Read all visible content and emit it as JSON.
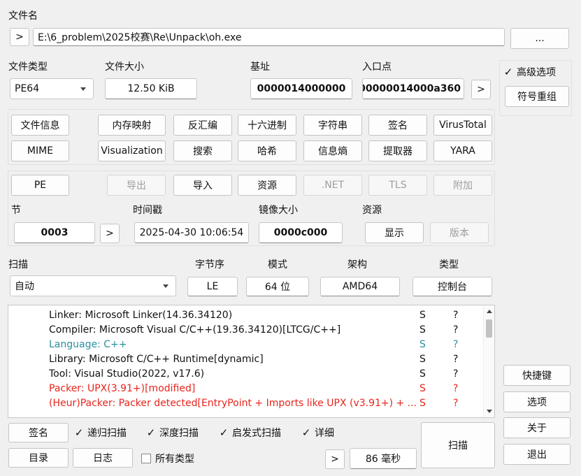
{
  "file": {
    "label": "文件名",
    "browse_arrow": ">",
    "path": "E:\\6_problem\\2025校赛\\Re\\Unpack\\oh.exe",
    "dots": "..."
  },
  "info": {
    "type_label": "文件类型",
    "type_value": "PE64",
    "size_label": "文件大小",
    "size_value": "12.50 KiB",
    "base_label": "基址",
    "base_value": "0000014000000",
    "entry_label": "入口点",
    "entry_value": "00000014000a360",
    "entry_arrow": ">"
  },
  "right_panel": {
    "advanced_check": "✓",
    "advanced_label": "高级选项",
    "symbol_button": "符号重组",
    "shortcut_button": "快捷键",
    "options_button": "选项",
    "about_button": "关于",
    "exit_button": "退出"
  },
  "tools_row1": [
    "文件信息",
    "内存映射",
    "反汇编",
    "十六进制",
    "字符串",
    "签名",
    "VirusTotal"
  ],
  "tools_row2": [
    "MIME",
    "Visualization",
    "搜索",
    "哈希",
    "信息熵",
    "提取器",
    "YARA"
  ],
  "pe_row": {
    "pe": "PE",
    "export": "导出",
    "import": "导入",
    "resource": "资源",
    "net": ".NET",
    "tls": "TLS",
    "overlay": "附加"
  },
  "section": {
    "section_label": "节",
    "section_value": "0003",
    "section_arrow": ">",
    "time_label": "时间戳",
    "time_value": "2025-04-30 10:06:54",
    "image_label": "镜像大小",
    "image_value": "0000c000",
    "res_label": "资源",
    "res_show": "显示",
    "res_version": "版本"
  },
  "scan": {
    "scan_label": "扫描",
    "scan_value": "自动",
    "endian_label": "字节序",
    "endian_value": "LE",
    "mode_label": "模式",
    "mode_value": "64 位",
    "arch_label": "架构",
    "arch_value": "AMD64",
    "type_label": "类型",
    "type_value": "控制台"
  },
  "results": [
    {
      "text": "Linker: Microsoft Linker(14.36.34120)",
      "s": "S",
      "q": "?",
      "color": "#111111"
    },
    {
      "text": "Compiler: Microsoft Visual C/C++(19.36.34120)[LTCG/C++]",
      "s": "S",
      "q": "?",
      "color": "#111111"
    },
    {
      "text": "Language: C++",
      "s": "S",
      "q": "?",
      "color": "#2a8fa0"
    },
    {
      "text": "Library: Microsoft C/C++ Runtime[dynamic]",
      "s": "S",
      "q": "?",
      "color": "#111111"
    },
    {
      "text": "Tool: Visual Studio(2022, v17.6)",
      "s": "S",
      "q": "?",
      "color": "#111111"
    },
    {
      "text": "Packer: UPX(3.91+)[modified]",
      "s": "S",
      "q": "?",
      "color": "#e8241c"
    },
    {
      "text": "(Heur)Packer: Packer detected[EntryPoint + Imports like UPX (v3.91+) + ...",
      "s": "S",
      "q": "?",
      "color": "#e8241c"
    }
  ],
  "bottom": {
    "sign_button": "签名",
    "recursive": "递归扫描",
    "deep": "深度扫描",
    "heuristic": "启发式扫描",
    "verbose": "详细",
    "dir_button": "目录",
    "log_button": "日志",
    "all_types": "所有类型",
    "arrow": ">",
    "elapsed": "86 毫秒",
    "scan_button": "扫描",
    "check": "✓"
  }
}
